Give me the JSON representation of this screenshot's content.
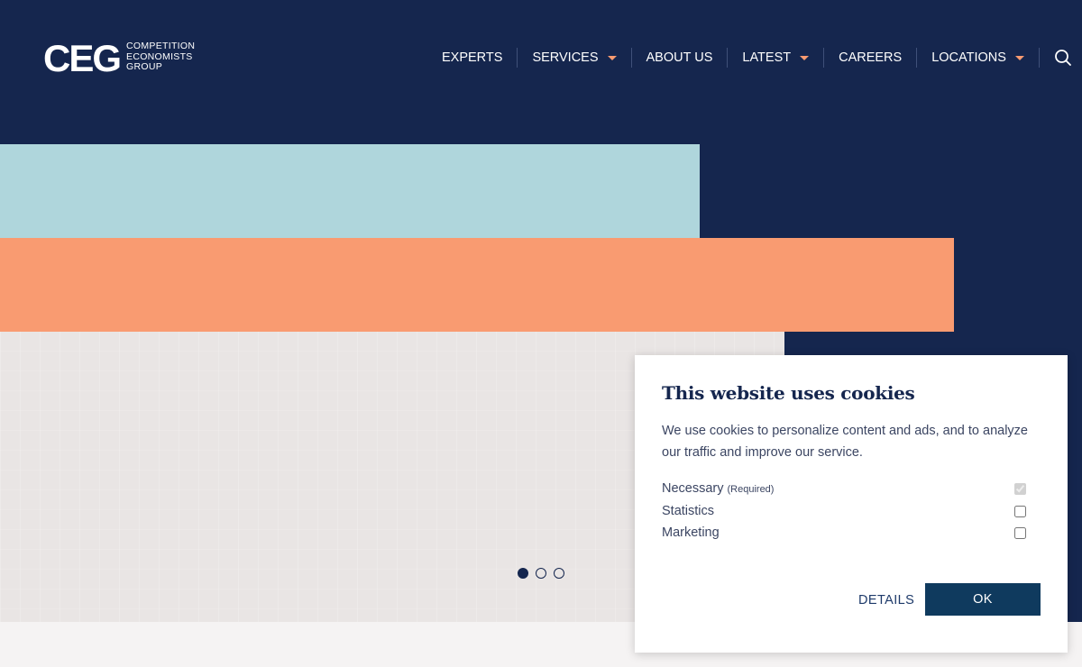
{
  "brand": {
    "logo_mark": "CEG",
    "logo_lines": [
      "COMPETITION",
      "ECONOMISTS",
      "GROUP"
    ]
  },
  "nav": {
    "items": [
      {
        "label": "EXPERTS",
        "dropdown": false
      },
      {
        "label": "SERVICES",
        "dropdown": true
      },
      {
        "label": "ABOUT US",
        "dropdown": false
      },
      {
        "label": "LATEST",
        "dropdown": true
      },
      {
        "label": "CAREERS",
        "dropdown": false
      },
      {
        "label": "LOCATIONS",
        "dropdown": true
      }
    ],
    "search_icon": "search-icon"
  },
  "hero": {
    "slide_count": 3,
    "active_slide": 1
  },
  "cookie_banner": {
    "title": "This website uses cookies",
    "body": "We use cookies to personalize content and ads, and to analyze our traffic and improve our service.",
    "options": [
      {
        "label": "Necessary",
        "note": "(Required)",
        "checked": true,
        "disabled": true
      },
      {
        "label": "Statistics",
        "note": "",
        "checked": false,
        "disabled": false
      },
      {
        "label": "Marketing",
        "note": "",
        "checked": false,
        "disabled": false
      }
    ],
    "details_label": "DETAILS",
    "ok_label": "OK"
  },
  "colors": {
    "navy": "#15264e",
    "light_blue": "#afd6dc",
    "orange": "#f99b71",
    "grey": "#e9e5e4",
    "button": "#0f3a5e"
  }
}
